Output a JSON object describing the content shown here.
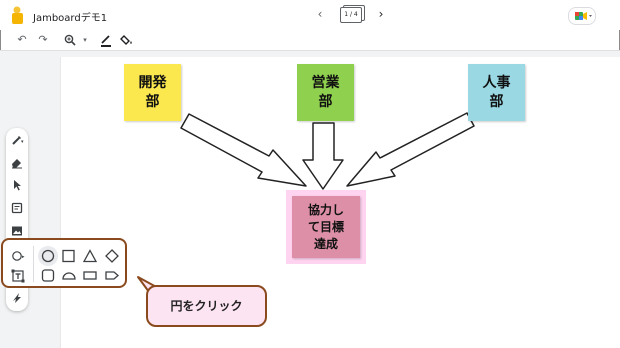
{
  "header": {
    "app_title": "Jamboardデモ1",
    "pager_text": "1 / 4",
    "prev_icon": "chevron-left-icon",
    "next_icon": "chevron-right-icon"
  },
  "toolbar": {
    "items": [
      "undo-icon",
      "redo-icon",
      "zoom-icon",
      "zoom-dropdown-icon",
      "pen-color-icon",
      "background-fill-icon"
    ]
  },
  "left_tools": [
    "pen-icon",
    "eraser-icon",
    "select-icon",
    "sticky-note-icon",
    "image-icon",
    "circle-icon",
    "text-box-icon",
    "laser-icon"
  ],
  "notes": [
    {
      "text": "開発\n部",
      "color": "#fbe74e"
    },
    {
      "text": "営業\n部",
      "color": "#8fd14f"
    },
    {
      "text": "人事\n部",
      "color": "#9ad8e4"
    },
    {
      "text": "協力し\nて目標\n達成",
      "color": "#dc8fa6"
    }
  ],
  "shape_panel": {
    "shapes": [
      "circle-shape",
      "square-shape",
      "triangle-shape",
      "diamond-shape",
      "rounded-square-shape",
      "semicircle-shape",
      "rectangle-shape",
      "arrow-shape"
    ]
  },
  "callout": {
    "text": "円をクリック"
  },
  "colors": {
    "highlight_glow": "#ffd4f0",
    "panel_border": "#8b4a1e",
    "callout_bg": "#fde4f3"
  }
}
